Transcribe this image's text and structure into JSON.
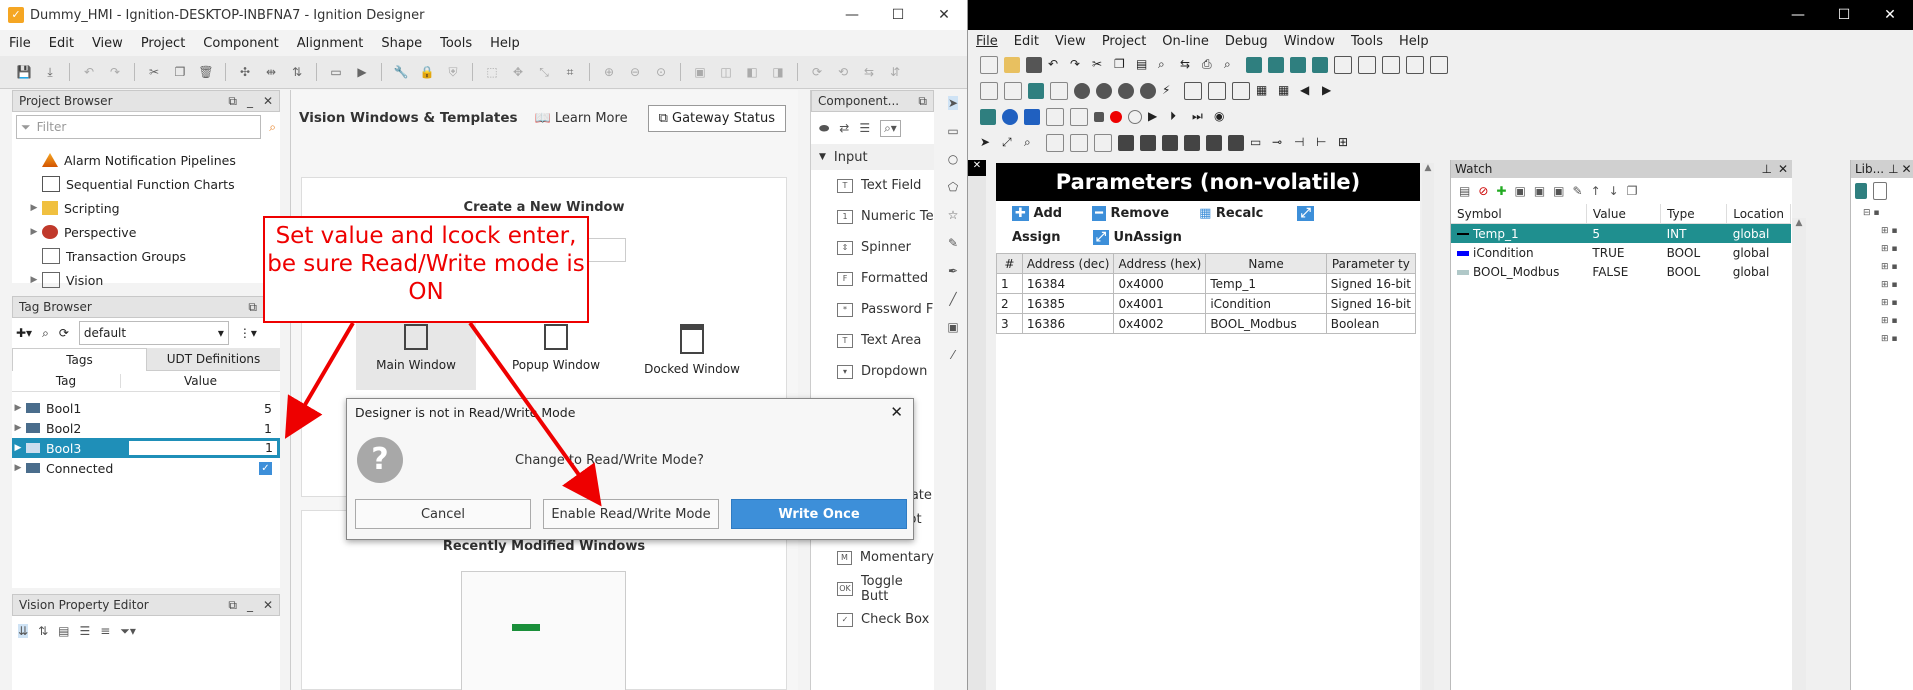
{
  "ignition": {
    "title": "Dummy_HMI - Ignition-DESKTOP-INBFNA7 - Ignition Designer",
    "menu": [
      "File",
      "Edit",
      "View",
      "Project",
      "Component",
      "Alignment",
      "Shape",
      "Tools",
      "Help"
    ],
    "project_browser": {
      "title": "Project Browser",
      "filter_placeholder": "Filter",
      "items": [
        "Alarm Notification Pipelines",
        "Sequential Function Charts",
        "Scripting",
        "Perspective",
        "Transaction Groups",
        "Vision"
      ]
    },
    "tag_browser": {
      "title": "Tag Browser",
      "provider": "default",
      "tabs": [
        "Tags",
        "UDT Definitions"
      ],
      "columns": [
        "Tag",
        "Value"
      ],
      "rows": [
        {
          "name": "Bool1",
          "value": "5"
        },
        {
          "name": "Bool2",
          "value": "1"
        },
        {
          "name": "Bool3",
          "value": "1"
        },
        {
          "name": "Connected",
          "value": ""
        }
      ]
    },
    "vision_property_editor": {
      "title": "Vision Property Editor"
    },
    "center": {
      "heading": "Vision Windows & Templates",
      "learn_more": "Learn More",
      "gateway_status": "Gateway Status",
      "create_title": "Create a New Window",
      "window_types": [
        "Main Window",
        "Popup Window",
        "Docked Window"
      ],
      "recent_title": "Recently Modified Windows"
    },
    "components": {
      "title": "Component...",
      "group": "Input",
      "items": [
        "Text Field",
        "Numeric Te",
        "Spinner",
        "Formatted",
        "Password F",
        "Text Area",
        "Dropdown",
        "Multi-State",
        "One-Shot B",
        "Momentary",
        "Toggle Butt",
        "Check Box"
      ]
    }
  },
  "dialog": {
    "title": "Designer is not in Read/Write Mode",
    "message": "Change to Read/Write Mode?",
    "buttons": {
      "cancel": "Cancel",
      "enable": "Enable Read/Write Mode",
      "write_once": "Write Once"
    }
  },
  "callout": {
    "text": "Set value and lcock enter, be sure Read/Write mode is ON",
    "color": "#e00000"
  },
  "codesys": {
    "menu": [
      "File",
      "Edit",
      "View",
      "Project",
      "On-line",
      "Debug",
      "Window",
      "Tools",
      "Help"
    ],
    "params": {
      "title": "Parameters (non-volatile)",
      "actions": [
        "Add",
        "Remove",
        "Recalc",
        "Assign",
        "UnAssign"
      ],
      "columns": [
        "#",
        "Address (dec)",
        "Address (hex)",
        "Name",
        "Parameter ty"
      ],
      "rows": [
        [
          "1",
          "16384",
          "0x4000",
          "Temp_1",
          "Signed 16-bit"
        ],
        [
          "2",
          "16385",
          "0x4001",
          "iCondition",
          "Signed 16-bit"
        ],
        [
          "3",
          "16386",
          "0x4002",
          "BOOL_Modbus",
          "Boolean"
        ]
      ]
    },
    "watch": {
      "title": "Watch",
      "columns": [
        "Symbol",
        "Value",
        "Type",
        "Location"
      ],
      "rows": [
        {
          "symbol": "Temp_1",
          "value": "5",
          "type": "INT",
          "location": "global",
          "color": "#000000"
        },
        {
          "symbol": "iCondition",
          "value": "TRUE",
          "type": "BOOL",
          "location": "global",
          "color": "#0000ff"
        },
        {
          "symbol": "BOOL_Modbus",
          "value": "FALSE",
          "type": "BOOL",
          "location": "global",
          "color": "#b0c8c8"
        }
      ]
    },
    "library": {
      "title": "Lib..."
    }
  },
  "colors": {
    "selection": "#1f8fb8",
    "accent": "#3d8fd9",
    "callout": "#e00000"
  }
}
